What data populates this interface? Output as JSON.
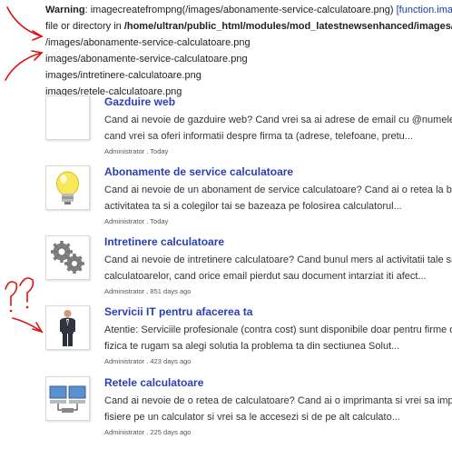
{
  "warning": {
    "label": "Warning",
    "line1_text": ": imagecreatefrompng(/images/abonamente-service-calculatoare.png) ",
    "line1_link": "[function.imagecreatefrompng]",
    "line2_prefix": "file or directory in ",
    "line2_path": "/home/ultran/public_html/modules/mod_latestnewsenhanced/images/",
    "lines": [
      "/images/abonamente-service-calculatoare.png",
      "images/abonamente-service-calculatoare.png",
      "images/intretinere-calculatoare.png",
      "images/retele-calculatoare.png"
    ]
  },
  "annotations": {
    "question_marks": "??",
    "color": "#e01010"
  },
  "articles": [
    {
      "title": "Gazduire web",
      "line1": "Cand ai nevoie de gazduire web? Cand vrei sa ai adrese de email cu @numele-firmei.ro?",
      "line2": "cand vrei sa oferi informatii despre firma ta (adrese, telefoane, pretu...",
      "meta": "Administrator . Today",
      "icon": "blank-thumbnail"
    },
    {
      "title": "Abonamente de service calculatoare",
      "line1": "Cand ai nevoie de un abonament de service calculatoare? Cand ai o retea la birou si",
      "line2": "activitatea ta si a colegilor tai se bazeaza pe folosirea calculatorul...",
      "meta": "Administrator . Today",
      "icon": "lightbulb-icon"
    },
    {
      "title": "Intretinere calculatoare",
      "line1": "Cand ai nevoie de intretinere calculatoare? Cand bunul mers al activitatii tale si a",
      "line2": "calculatoarelor, cand orice email pierdut sau document intarziat iti afect...",
      "meta": "Administrator . 851 days ago",
      "icon": "gears-icon"
    },
    {
      "title": "Servicii IT pentru afacerea ta",
      "line1": "Atentie: Serviciile profesionale (contra cost) sunt disponibile doar pentru firme din Ro",
      "line2": "fizica te rugam sa alegi solutia la problema ta din sectiunea Solut...",
      "meta": "Administrator . 423 days ago",
      "icon": "businessman-icon"
    },
    {
      "title": "Retele calculatoare",
      "line1": "Cand ai nevoie de o retea de calculatoare? Cand ai o imprimanta si vrei sa imprimi de la",
      "line2": "fisiere pe un calculator si vrei sa le accesezi si de pe alt calculato...",
      "meta": "Administrator . 225 days ago",
      "icon": "network-computers-icon"
    }
  ]
}
